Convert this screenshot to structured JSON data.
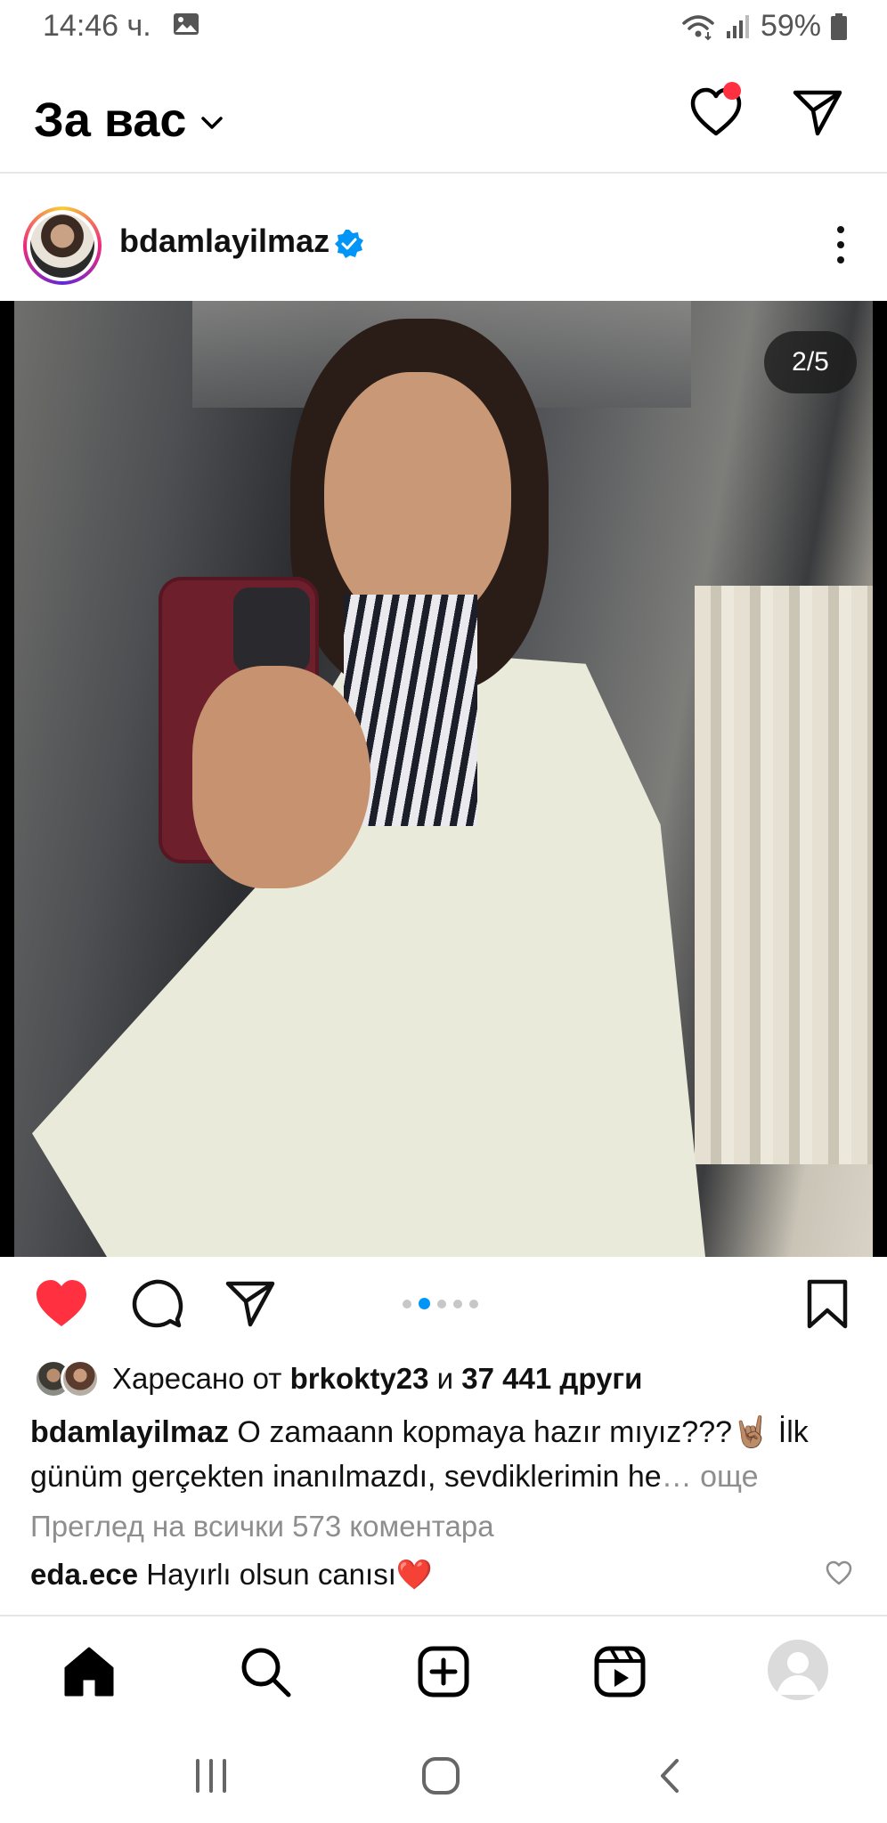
{
  "status_bar": {
    "time": "14:46 ч.",
    "battery": "59%"
  },
  "header": {
    "title": "За вас"
  },
  "post": {
    "username": "bdamlayilmaz",
    "carousel_counter": "2/5",
    "carousel": {
      "total": 5,
      "current": 2
    },
    "likes": {
      "prefix": "Харесано от ",
      "user": "brkokty23",
      "middle": " и ",
      "count": "37 441 други"
    },
    "caption": {
      "username": "bdamlayilmaz",
      "text": " O zamaann kopmaya hazır mıyız???🤘🏽 İlk günüm gerçekten inanılmazdı, sevdiklerimin he",
      "ellipsis": "…",
      "more": " още"
    },
    "view_comments": "Преглед на всички 573 коментара",
    "comment": {
      "username": "eda.ece",
      "text": " Hayırlı olsun canısı❤️"
    }
  },
  "colors": {
    "like_red": "#ff3040",
    "verified_blue": "#0095f6",
    "muted_text": "#8e8e8e"
  },
  "icons": [
    "image-icon",
    "wifi-icon",
    "signal-icon",
    "battery-icon",
    "chevron-down-icon",
    "heart-icon",
    "send-icon",
    "verified-icon",
    "more-vertical-icon",
    "comment-icon",
    "bookmark-icon",
    "home-icon",
    "search-icon",
    "create-icon",
    "reels-icon",
    "profile-icon",
    "recents-icon",
    "home-circle-icon",
    "back-icon"
  ]
}
